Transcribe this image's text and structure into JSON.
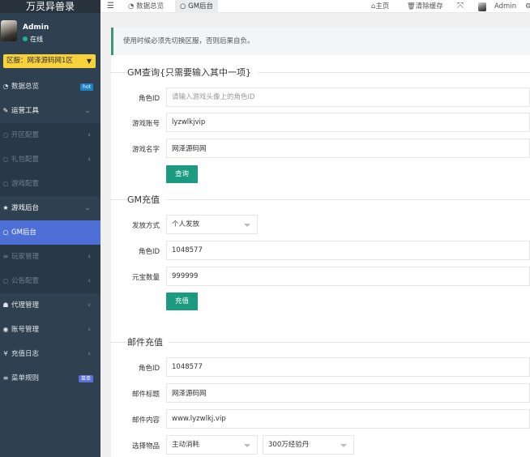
{
  "sidebar": {
    "app_title": "万灵异兽录",
    "user": {
      "name": "Admin",
      "status": "在线"
    },
    "server_select": {
      "value": "区服：网泽源码网1区"
    },
    "items": [
      {
        "label": "数据总览",
        "icon": "dashboard-icon",
        "badge": "hot",
        "type": "top"
      },
      {
        "label": "运营工具",
        "icon": "tools-icon",
        "type": "parent-open"
      },
      {
        "label": "开区配置",
        "type": "sub"
      },
      {
        "label": "礼包配置",
        "type": "sub"
      },
      {
        "label": "游戏配置",
        "type": "sub"
      },
      {
        "label": "游戏后台",
        "icon": "star-icon",
        "type": "parent-open"
      },
      {
        "label": "GM后台",
        "type": "active"
      },
      {
        "label": "玩家管理",
        "icon": "list-icon",
        "type": "sub"
      },
      {
        "label": "公告配置",
        "type": "sub"
      },
      {
        "label": "代理管理",
        "icon": "agent-icon",
        "type": "top"
      },
      {
        "label": "账号管理",
        "icon": "account-icon",
        "type": "top"
      },
      {
        "label": "充值日志",
        "icon": "yen-icon",
        "type": "top"
      },
      {
        "label": "菜单规则",
        "icon": "menu-icon",
        "badge": "new",
        "type": "top"
      }
    ]
  },
  "topbar": {
    "tabs": [
      {
        "label": "数据总览"
      },
      {
        "label": "GM后台"
      }
    ],
    "home": "主页",
    "clear_cache": "清除缓存",
    "admin": "Admin"
  },
  "notice": "使用时候必须先切换区服，否则后果自负。",
  "gm_query": {
    "legend": "GM查询{只需要输入其中一项}",
    "role_id_label": "角色ID",
    "role_id_placeholder": "请输入游戏头像上的角色ID",
    "account_label": "游戏账号",
    "account_value": "lyzwlkjvip",
    "name_label": "游戏名字",
    "name_value": "网泽源码网",
    "button": "查询"
  },
  "gm_recharge": {
    "legend": "GM充值",
    "method_label": "发放方式",
    "method_value": "个人发放",
    "role_id_label": "角色ID",
    "role_id_value": "1048577",
    "amount_label": "元宝数量",
    "amount_value": "999999",
    "button": "充值"
  },
  "mail": {
    "legend": "邮件充值",
    "role_id_label": "角色ID",
    "role_id_value": "1048577",
    "title_label": "邮件标题",
    "title_value": "网泽源码网",
    "content_label": "邮件内容",
    "content_value": "www.lyzwlkj.vip",
    "item_label": "选择物品",
    "item_type_value": "主动消耗",
    "item_value": "300万经验丹"
  },
  "colors": {
    "sidebar_bg": "#2f4050",
    "active_menu": "#4e6fd6",
    "primary_button": "#1a9b82",
    "server_select": "#f8d23c"
  }
}
